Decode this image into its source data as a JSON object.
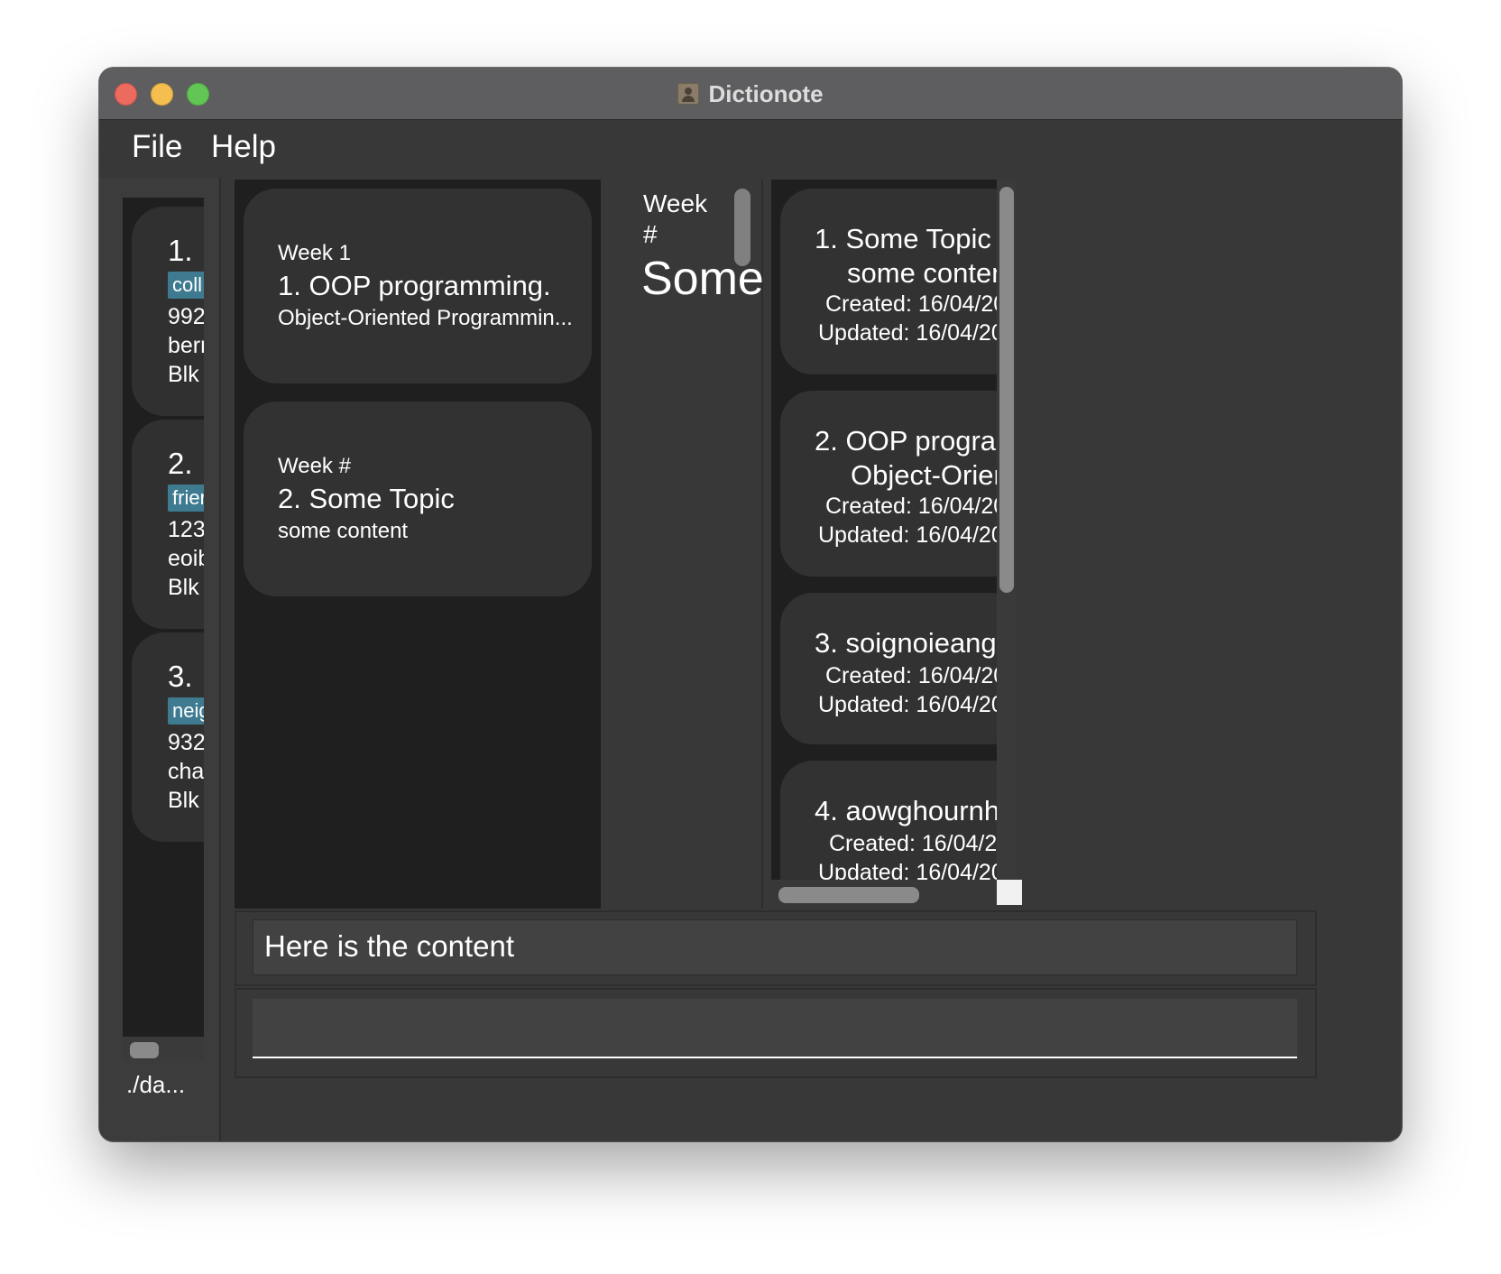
{
  "window": {
    "title": "Dictionote"
  },
  "menu": {
    "file": "File",
    "help": "Help"
  },
  "contacts": [
    {
      "index": "1.",
      "tag": "coll",
      "lines": [
        "992",
        "berr",
        "Blk"
      ]
    },
    {
      "index": "2.",
      "tag": "frier",
      "lines": [
        "123",
        "eoib",
        "Blk"
      ]
    },
    {
      "index": "3.",
      "tag": "neig",
      "lines": [
        "932",
        "cha",
        "Blk"
      ]
    }
  ],
  "status_bar": {
    "path": "./da..."
  },
  "notes": [
    {
      "week": "Week 1",
      "title": "1.  OOP programming.",
      "content": "Object-Oriented Programmin..."
    },
    {
      "week": "Week #",
      "title": "2.  Some Topic",
      "content": "some content"
    }
  ],
  "note_detail": {
    "week": "Week #",
    "topic": "Some"
  },
  "history": [
    {
      "title": "1.  Some Topic",
      "sub": "some conten",
      "created": "Created: 16/04/20",
      "updated": "Updated: 16/04/20"
    },
    {
      "title": "2.  OOP prograr",
      "sub": "Object-Orier",
      "created": "Created: 16/04/20",
      "updated": "Updated: 16/04/20"
    },
    {
      "title": "3.  soignoieangi",
      "sub": "",
      "created": "Created: 16/04/20",
      "updated": "Updated: 16/04/20"
    },
    {
      "title": "4.  aowghournh",
      "sub": "",
      "created": "Created: 16/04/20",
      "updated": "Updated: 16/04/20"
    }
  ],
  "result_display": {
    "text": "Here is the content"
  },
  "command_box": {
    "value": "",
    "placeholder": ""
  }
}
